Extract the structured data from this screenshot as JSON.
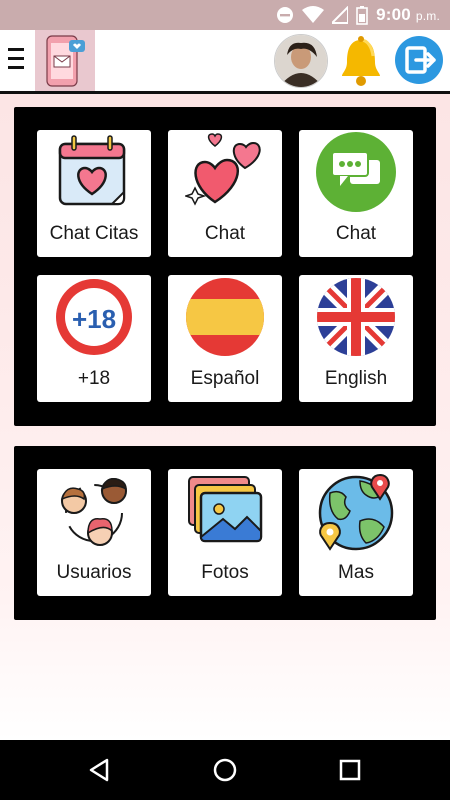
{
  "status_bar": {
    "time": "9:00",
    "time_suffix": "p.m."
  },
  "app_bar": {
    "menu_icon": "hamburger-menu-icon",
    "logo_icon": "phone-mail-logo",
    "avatar": "user-avatar",
    "notification_icon": "bell-icon",
    "logout_icon": "exit-icon"
  },
  "grid": {
    "tiles": [
      {
        "label": "Chat Citas",
        "icon": "calendar-heart-icon"
      },
      {
        "label": "Chat",
        "icon": "hearts-icon"
      },
      {
        "label": "Chat",
        "icon": "chat-bubble-icon"
      },
      {
        "label": "+18",
        "icon": "plus18-icon"
      },
      {
        "label": "Español",
        "icon": "spain-flag-icon"
      },
      {
        "label": "English",
        "icon": "uk-flag-icon"
      }
    ]
  },
  "grid2": {
    "tiles": [
      {
        "label": "Usuarios",
        "icon": "users-icon"
      },
      {
        "label": "Fotos",
        "icon": "photos-icon"
      },
      {
        "label": "Mas",
        "icon": "globe-pin-icon"
      }
    ]
  },
  "plus18_text": "+18",
  "colors": {
    "status_bar": "#c9acad",
    "accent_red": "#e53935",
    "panel": "#000000"
  }
}
